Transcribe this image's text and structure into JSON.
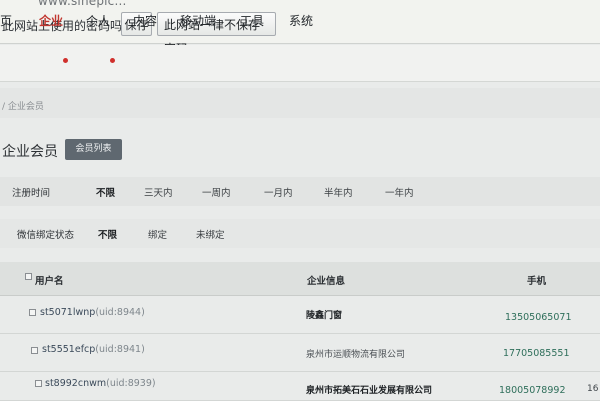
{
  "browser": {
    "url_fragment": "www.sinepic...",
    "prompt": "此网站上使用的密码吗？",
    "save_label": "保存",
    "never_label": "此网站一律不保存密码"
  },
  "nav": {
    "items": [
      {
        "label": "页"
      },
      {
        "label": "企业",
        "active": true,
        "dot": true
      },
      {
        "label": "个人",
        "dot": true
      },
      {
        "label": "内容"
      },
      {
        "label": "移动端"
      },
      {
        "label": "工具"
      },
      {
        "label": "系统"
      }
    ]
  },
  "breadcrumb": "/ 企业会员",
  "page": {
    "title": "企业会员",
    "list_button": "会员列表"
  },
  "filters": {
    "reg_time": {
      "label": "注册时间",
      "options": [
        "不限",
        "三天内",
        "一周内",
        "一月内",
        "半年内",
        "一年内"
      ],
      "selected": "不限"
    },
    "wechat": {
      "label": "微信绑定状态",
      "options": [
        "不限",
        "绑定",
        "未绑定"
      ],
      "selected": "不限"
    }
  },
  "table": {
    "headers": {
      "username": "用户名",
      "company": "企业信息",
      "phone": "手机"
    },
    "rows": [
      {
        "username": "st5071lwnp",
        "uid": "(uid:8944)",
        "company": "陵鑫门窗",
        "phone": "13505065071",
        "edge": ""
      },
      {
        "username": "st5551efcp",
        "uid": "(uid:8941)",
        "company": "泉州市运顺物流有限公司",
        "phone": "17705085551",
        "edge": ""
      },
      {
        "username": "st8992cnwm",
        "uid": "(uid:8939)",
        "company": "泉州市拓美石石业发展有限公司",
        "phone": "18005078992",
        "edge": "16"
      }
    ]
  },
  "colors": {
    "accent_red": "#c1362f",
    "phone_green": "#2f6f5b",
    "list_button_bg": "#5f6870"
  }
}
